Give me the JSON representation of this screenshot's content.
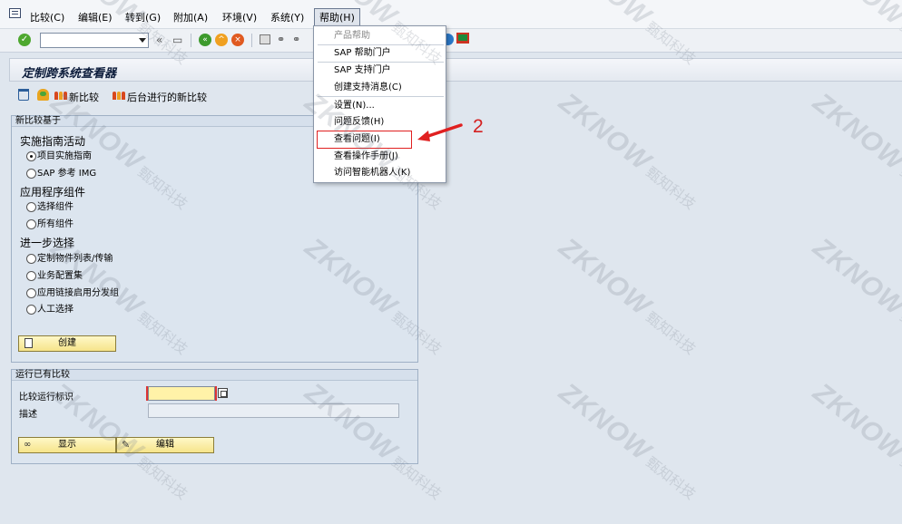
{
  "menubar": {
    "items": [
      "比较(C)",
      "编辑(E)",
      "转到(G)",
      "附加(A)",
      "环境(V)",
      "系统(Y)",
      "帮助(H)"
    ]
  },
  "toolbar": {
    "nav_back_glyph": "«",
    "icons": [
      "check-icon",
      "command-field",
      "save-icon",
      "back-icon",
      "exit-icon",
      "cancel-icon",
      "print-icon",
      "find-icon",
      "help-icon",
      "layout-icon"
    ]
  },
  "title": "定制跨系统查看器",
  "app_toolbar": {
    "new_compare": "新比较",
    "new_compare_background": "后台进行的新比较"
  },
  "group_new": {
    "title": "新比较基于",
    "sections": [
      {
        "heading": "实施指南活动",
        "options": [
          {
            "label": "项目实施指南",
            "selected": true
          },
          {
            "label": "SAP 参考 IMG",
            "selected": false
          }
        ]
      },
      {
        "heading": "应用程序组件",
        "options": [
          {
            "label": "选择组件",
            "selected": false
          },
          {
            "label": "所有组件",
            "selected": false
          }
        ]
      },
      {
        "heading": "进一步选择",
        "options": [
          {
            "label": "定制物件列表/传输",
            "selected": false
          },
          {
            "label": "业务配置集",
            "selected": false
          },
          {
            "label": "应用链接启用分发组",
            "selected": false
          },
          {
            "label": "人工选择",
            "selected": false
          }
        ]
      }
    ],
    "create_button": "创建"
  },
  "group_run": {
    "title": "运行已有比较",
    "run_id_label": "比较运行标识",
    "run_id_value": "",
    "desc_label": "描述",
    "desc_value": "",
    "display_button": "显示",
    "edit_button": "编辑"
  },
  "help_menu": {
    "items": [
      {
        "label": "产品帮助",
        "disabled": true
      },
      {
        "label": "SAP 帮助门户",
        "disabled": false
      },
      {
        "label": "SAP 支持门户",
        "disabled": false
      },
      {
        "label": "创建支持消息(C)",
        "disabled": false
      },
      {
        "label": "设置(N)...",
        "disabled": false
      },
      {
        "label": "问题反馈(H)",
        "disabled": false
      },
      {
        "label": "查看问题(I)",
        "disabled": false
      },
      {
        "label": "查看操作手册(J)",
        "disabled": false
      },
      {
        "label": "访问智能机器人(K)",
        "disabled": false
      }
    ]
  },
  "annotation": {
    "step_number": "2",
    "color": "#e02020"
  },
  "watermark": {
    "logo": "ZKNOW",
    "text": "甄知科技"
  }
}
